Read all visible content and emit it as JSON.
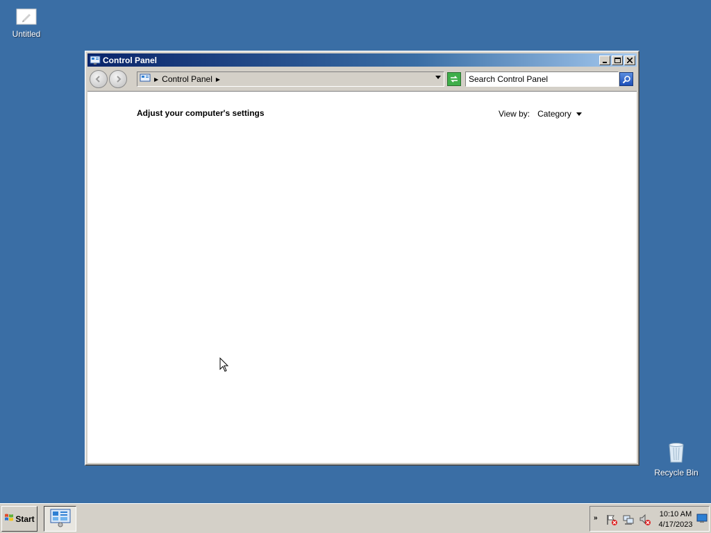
{
  "desktop": {
    "icons": [
      {
        "label": "Untitled",
        "icon": "document-icon"
      },
      {
        "label": "Recycle Bin",
        "icon": "recycle-bin-icon"
      }
    ],
    "background_color": "#3a6ea5"
  },
  "window": {
    "title": "Control Panel",
    "buttons": {
      "minimize": "_",
      "maximize": "□",
      "close": "✕"
    }
  },
  "toolbar": {
    "breadcrumb": [
      "Control Panel"
    ],
    "search_placeholder": "Search Control Panel"
  },
  "content": {
    "heading": "Adjust your computer's settings",
    "view_by_label": "View by:",
    "view_by_value": "Category"
  },
  "taskbar": {
    "start_label": "Start",
    "clock_time": "10:10 AM",
    "clock_date": "4/17/2023",
    "tray_chevron": "»"
  }
}
